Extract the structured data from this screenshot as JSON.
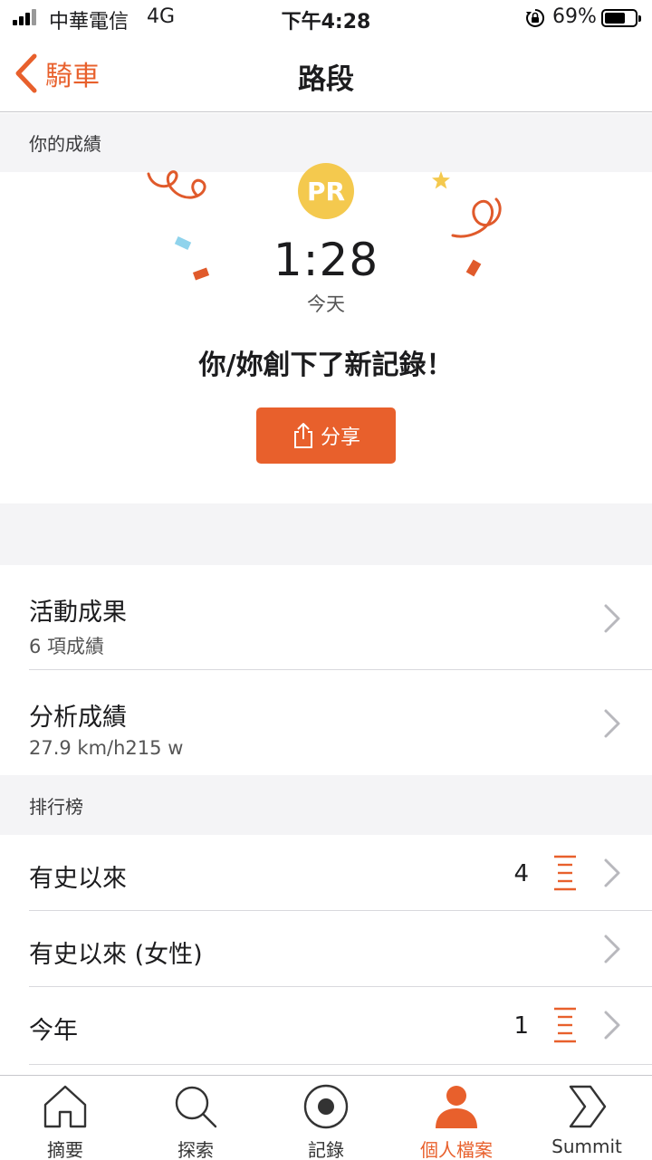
{
  "status_bar": {
    "carrier": "中華電信",
    "network": "4G",
    "time": "下午4:28",
    "battery": "69%",
    "battery_level": 0.69
  },
  "nav": {
    "back_label": "騎車",
    "title": "路段"
  },
  "your_results": {
    "header": "你的成績",
    "badge": "PR",
    "time": "1:28",
    "date": "今天",
    "message": "你/妳創下了新記錄！",
    "share_label": "分享"
  },
  "stats": [
    {
      "title": "活動成果",
      "subtitle": "6 項成績"
    },
    {
      "title": "分析成績",
      "subtitle": "27.9 km/h215 w"
    }
  ],
  "leaderboard": {
    "header": "排行榜",
    "rows": [
      {
        "title": "有史以來",
        "rank": "4"
      },
      {
        "title": "有史以來 (女性)",
        "rank": ""
      },
      {
        "title": "今年",
        "rank": "1"
      }
    ]
  },
  "tab_bar": {
    "tabs": [
      {
        "label": "摘要",
        "icon": "home-icon",
        "active": false
      },
      {
        "label": "探索",
        "icon": "search-icon",
        "active": false
      },
      {
        "label": "記錄",
        "icon": "record-icon",
        "active": false
      },
      {
        "label": "個人檔案",
        "icon": "profile-icon",
        "active": true
      },
      {
        "label": "Summit",
        "icon": "summit-icon",
        "active": false
      }
    ]
  },
  "colors": {
    "accent": "#e8602c",
    "pr_gold": "#f4c94e",
    "section_bg": "#f4f4f6"
  }
}
